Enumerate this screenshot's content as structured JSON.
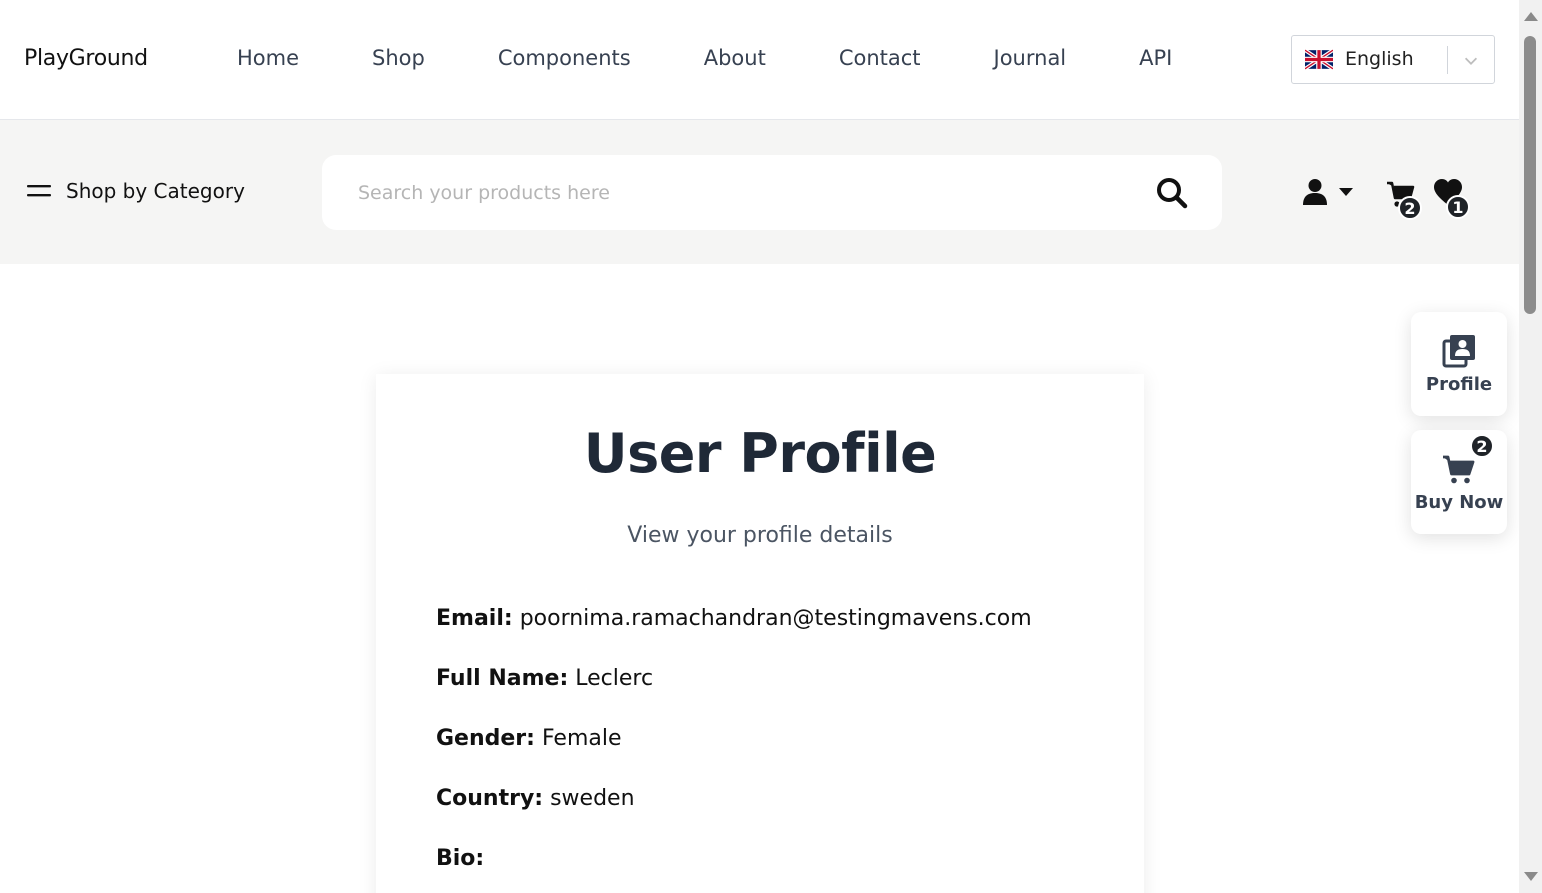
{
  "brand": "PlayGround",
  "nav": {
    "items": [
      {
        "label": "Home"
      },
      {
        "label": "Shop"
      },
      {
        "label": "Components"
      },
      {
        "label": "About"
      },
      {
        "label": "Contact"
      },
      {
        "label": "Journal"
      },
      {
        "label": "API"
      }
    ]
  },
  "language": {
    "selected": "English",
    "flag_icon": "uk-flag-icon"
  },
  "category": {
    "label": "Shop by Category",
    "icon": "hamburger-menu-icon"
  },
  "search": {
    "placeholder": "Search your products here",
    "value": "",
    "icon": "search-icon"
  },
  "header_icons": {
    "user_icon": "user-icon",
    "cart_count": "2",
    "wishlist_count": "1"
  },
  "floating": {
    "profile_label": "Profile",
    "buy_label": "Buy Now",
    "buy_count": "2"
  },
  "profile": {
    "title": "User Profile",
    "subtitle": "View your profile details",
    "fields": [
      {
        "key": "Email:",
        "value": "poornima.ramachandran@testingmavens.com"
      },
      {
        "key": "Full Name:",
        "value": "Leclerc"
      },
      {
        "key": "Gender:",
        "value": "Female"
      },
      {
        "key": "Country:",
        "value": "sweden"
      },
      {
        "key": "Bio:",
        "value": ""
      }
    ]
  },
  "colors": {
    "text_dark": "#1f2937",
    "subheader_bg": "#f5f5f4",
    "badge_bg": "#1f2328"
  }
}
